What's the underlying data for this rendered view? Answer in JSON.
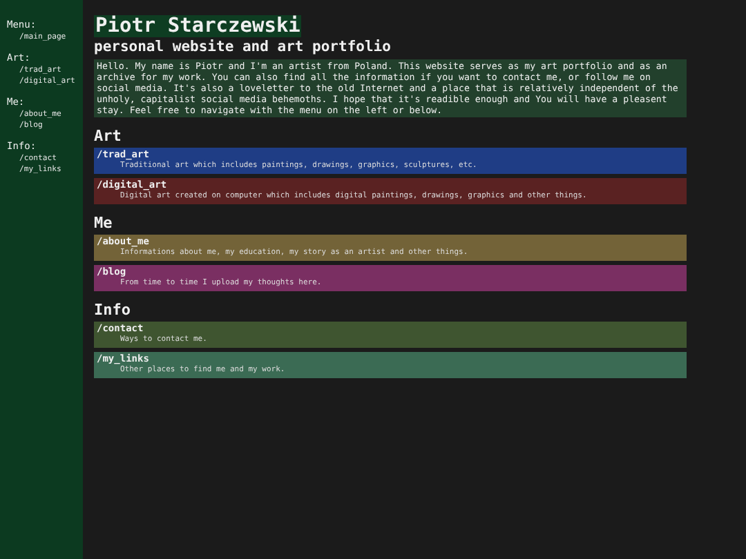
{
  "sidebar": {
    "groups": [
      {
        "heading": "Menu:",
        "links": [
          "/main_page"
        ]
      },
      {
        "heading": "Art:",
        "links": [
          "/trad_art",
          "/digital_art"
        ]
      },
      {
        "heading": "Me:",
        "links": [
          "/about_me",
          "/blog"
        ]
      },
      {
        "heading": "Info:",
        "links": [
          "/contact",
          "/my_links"
        ]
      }
    ]
  },
  "header": {
    "title": "Piotr Starczewski",
    "subtitle": "personal website and art portfolio"
  },
  "intro": "Hello. My name is Piotr and I'm an artist from Poland. This website serves as my art portfolio and as an archive for my work. You can also find all the information if you want to contact me, or follow me on social media. It's also a loveletter to the old Internet and a place that is relatively independent of the unholy, capitalist social media behemoths. I hope that it's readible enough and You will have a pleasent stay. Feel free to navigate with the menu on the left or below.",
  "sections": [
    {
      "heading": "Art",
      "cards": [
        {
          "title": "/trad_art",
          "description": "Traditional art which includes paintings, drawings, graphics, sculptures, etc.",
          "color": "#1f3d85"
        },
        {
          "title": "/digital_art",
          "description": "Digital art created on computer which includes digital paintings, drawings, graphics and other things.",
          "color": "#5a2222"
        }
      ]
    },
    {
      "heading": "Me",
      "cards": [
        {
          "title": "/about_me",
          "description": "Informations about me, my education, my story as an artist and other things.",
          "color": "#736338"
        },
        {
          "title": "/blog",
          "description": "From time to time I upload my thoughts here.",
          "color": "#7a2f62"
        }
      ]
    },
    {
      "heading": "Info",
      "cards": [
        {
          "title": "/contact",
          "description": "Ways to contact me.",
          "color": "#3f5530"
        },
        {
          "title": "/my_links",
          "description": "Other places to find me and my work.",
          "color": "#3b6b54"
        }
      ]
    }
  ]
}
